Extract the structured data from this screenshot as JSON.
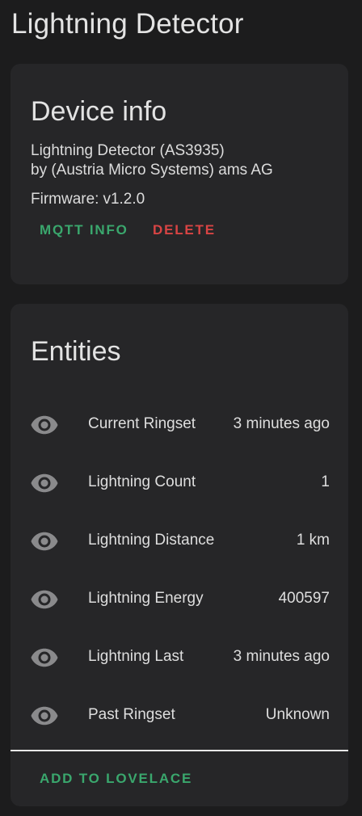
{
  "page": {
    "title": "Lightning Detector"
  },
  "device_info": {
    "header": "Device info",
    "model": "Lightning Detector (AS3935)",
    "manufacturer": "by (Austria Micro Systems) ams AG",
    "firmware_label": "Firmware:",
    "firmware_version": "v1.2.0",
    "buttons": {
      "mqtt_info": "MQTT INFO",
      "delete": "DELETE"
    }
  },
  "entities": {
    "header": "Entities",
    "items": [
      {
        "name": "Current Ringset",
        "state": "3 minutes ago",
        "icon": "eye-icon"
      },
      {
        "name": "Lightning Count",
        "state": "1",
        "icon": "eye-icon"
      },
      {
        "name": "Lightning Distance",
        "state": "1 km",
        "icon": "eye-icon"
      },
      {
        "name": "Lightning Energy",
        "state": "400597",
        "icon": "eye-icon"
      },
      {
        "name": "Lightning Last",
        "state": "3 minutes ago",
        "icon": "eye-icon"
      },
      {
        "name": "Past Ringset",
        "state": "Unknown",
        "icon": "eye-icon"
      }
    ],
    "add_button": "ADD TO LOVELACE"
  },
  "colors": {
    "background": "#1c1c1d",
    "card": "#262628",
    "accent_green": "#3aa76d",
    "danger_red": "#d84444",
    "icon_gray": "#8a8a8c"
  }
}
